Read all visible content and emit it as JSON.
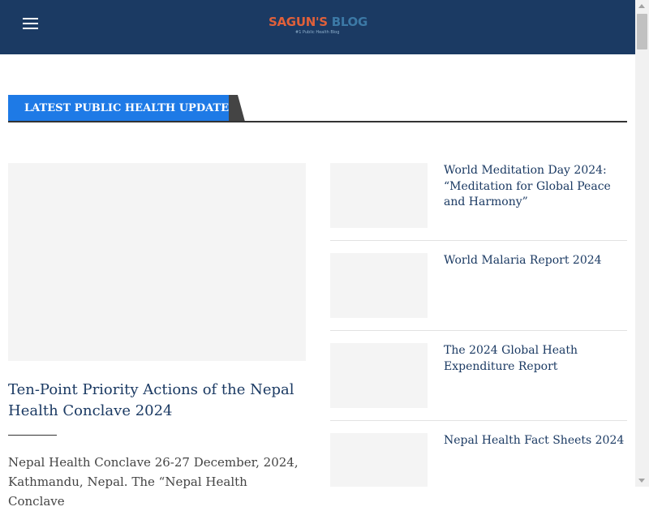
{
  "header": {
    "logo_part1": "SAGUN'S",
    "logo_part2": "BLOG",
    "logo_tagline": "#1 Public Health Blog"
  },
  "section": {
    "title": "LATEST PUBLIC HEALTH UPDATE"
  },
  "featured": {
    "title": "Ten-Point Priority Actions of the Nepal Health Conclave 2024",
    "excerpt": "Nepal Health Conclave 26-27 December, 2024, Kathmandu, Nepal. The “Nepal Health Conclave"
  },
  "side_posts": [
    {
      "title": "World Meditation Day 2024: “Meditation for Global Peace and Harmony”"
    },
    {
      "title": "World Malaria Report 2024"
    },
    {
      "title": "The 2024 Global Heath Expenditure Report"
    },
    {
      "title": "Nepal Health Fact Sheets 2024"
    }
  ],
  "colors": {
    "header_bg": "#1b3a63",
    "accent": "#1e7ae6",
    "logo_orange": "#e0603a",
    "logo_blue": "#3c79a6"
  }
}
